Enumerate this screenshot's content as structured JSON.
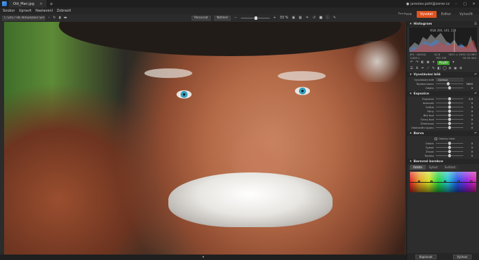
{
  "titlebar": {
    "tab_title": "Old_Man.jpg",
    "tab_close": "×",
    "new_tab": "+",
    "user": "jaroslav.pohl@zoner.cz",
    "win_min": "–",
    "win_max": "□",
    "win_close": "✕"
  },
  "menu": {
    "items": [
      "Soubor",
      "Upravit",
      "Nastavení",
      "Zobrazit"
    ]
  },
  "modules": [
    "Správce",
    "Vyvolat",
    "Editor",
    "Vytvořit"
  ],
  "active_module": "Vyvolat",
  "toolbar": {
    "folder": "C:\\2017-06 Aktualizace Screenshotů",
    "compare_label": "Porovnat",
    "view_label": "Náhled",
    "zoom": "33 %"
  },
  "panel": {
    "histogram": {
      "title": "Histogram",
      "rgb": "RGB 200, 145, 128",
      "exif_left": [
        "JPG · (Dt:EX)",
        "1/400 s"
      ],
      "exif_mid": [
        "f/2.8",
        "ISO 100"
      ],
      "exif_right": [
        "3872 × 2592 (10 MP)",
        "50.00 mm"
      ]
    },
    "apply_label": "Použít",
    "white_balance": {
      "title": "Vyvolávání bílé",
      "rows": [
        {
          "label": "Vyvolávání bílé",
          "value": "Výchozí"
        },
        {
          "label": "Teplota barev",
          "value": "5600",
          "pos": 0.45
        },
        {
          "label": "Odstín",
          "value": "0",
          "pos": 0.5
        }
      ]
    },
    "exposure": {
      "title": "Expozice",
      "rows": [
        {
          "label": "Expozice",
          "value": "0.0",
          "pos": 0.5
        },
        {
          "label": "Kontrast",
          "value": "0",
          "pos": 0.5
        },
        {
          "label": "Světla",
          "value": "0",
          "pos": 0.5
        },
        {
          "label": "Stíny",
          "value": "0",
          "pos": 0.5
        },
        {
          "label": "Bílý bod",
          "value": "0",
          "pos": 0.5
        },
        {
          "label": "Černý bod",
          "value": "0",
          "pos": 0.5
        },
        {
          "label": "Zřetelnost",
          "value": "0",
          "pos": 0.5
        },
        {
          "label": "Odstranění oparu",
          "value": "0",
          "pos": 0.5
        }
      ]
    },
    "color": {
      "title": "Barva",
      "checkbox": "Odstíny šedi",
      "rows": [
        {
          "label": "Odstín",
          "value": "0",
          "pos": 0.5
        },
        {
          "label": "Sytost",
          "value": "0",
          "pos": 0.5
        },
        {
          "label": "Živost",
          "value": "0",
          "pos": 0.5
        },
        {
          "label": "Teplota",
          "value": "0",
          "pos": 0.5
        }
      ]
    },
    "color_shift": {
      "title": "Barevné korekce",
      "tabs": [
        "Odstín",
        "Sytost",
        "Světlost"
      ],
      "active_tab": "Odstín"
    },
    "footer": {
      "copy": "Kopírovat",
      "reset": "Výchozí"
    }
  }
}
